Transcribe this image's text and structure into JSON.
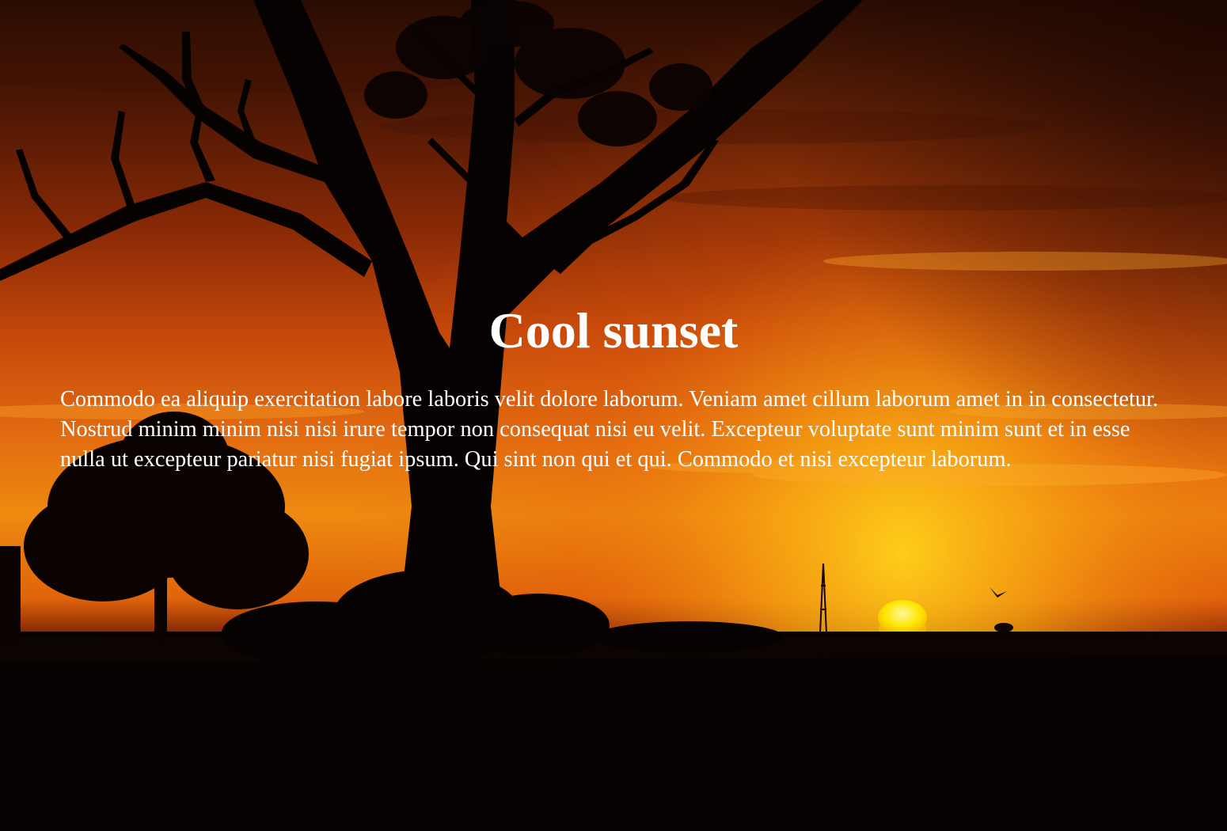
{
  "hero": {
    "title": "Cool sunset",
    "paragraph": "Commodo ea aliquip exercitation labore laboris velit dolore laborum. Veniam amet cillum laborum amet in in consectetur. Nostrud minim minim nisi nisi irure tempor non consequat nisi eu velit. Excepteur voluptate sunt minim sunt et in esse nulla ut excepteur pariatur nisi fugiat ipsum. Qui sint non qui et qui. Commodo et nisi excepteur laborum."
  },
  "colors": {
    "text": "#ffffff",
    "sky_top": "#2a0c02",
    "sky_mid": "#d9520d",
    "sky_glow": "#f7b40c",
    "sun": "#ffe600",
    "ground": "#050202"
  }
}
